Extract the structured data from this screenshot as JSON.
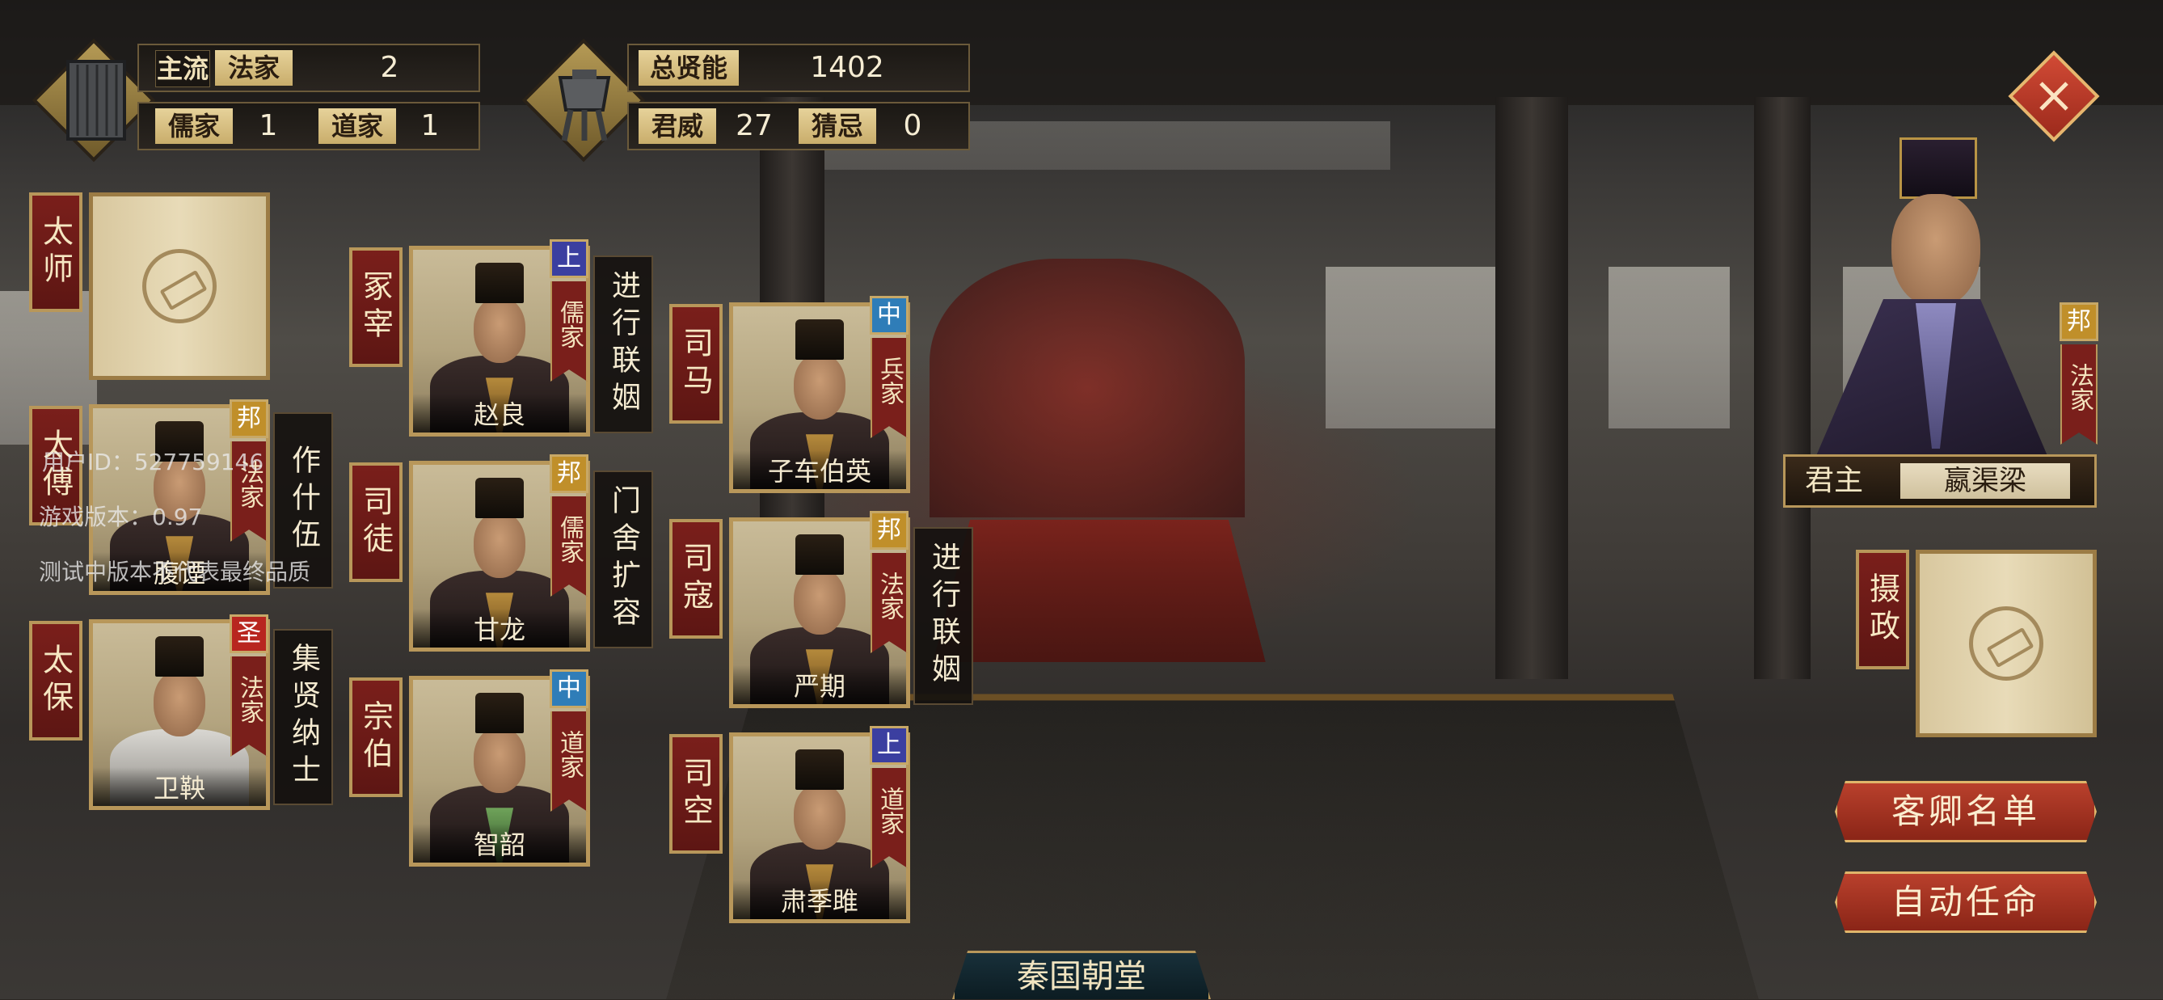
{
  "hud": {
    "mainstream_label": "主流",
    "mainstream_school": "法家",
    "mainstream_count": "2",
    "school2_label": "儒家",
    "school2_count": "1",
    "school3_label": "道家",
    "school3_count": "1",
    "total_talent_label": "总贤能",
    "total_talent_value": "1402",
    "prestige_label": "君威",
    "prestige_value": "27",
    "suspicion_label": "猜忌",
    "suspicion_value": "0"
  },
  "offices_left": [
    {
      "title": "太师",
      "empty": true
    },
    {
      "title": "太傅",
      "name": "腹𬤇",
      "rank": "邦",
      "school": "法家",
      "task": "作什伍"
    },
    {
      "title": "太保",
      "name": "卫鞅",
      "rank": "圣",
      "school": "法家",
      "task": "集贤纳士"
    }
  ],
  "offices_mid": [
    {
      "title": "冢宰",
      "name": "赵良",
      "rank": "上",
      "school": "儒家",
      "task": "进行联姻"
    },
    {
      "title": "司徒",
      "name": "甘龙",
      "rank": "邦",
      "school": "儒家",
      "task": "门舍扩容"
    },
    {
      "title": "宗伯",
      "name": "智韶",
      "rank": "中",
      "school": "道家",
      "task": ""
    }
  ],
  "offices_right": [
    {
      "title": "司马",
      "name": "子车伯英",
      "rank": "中",
      "school": "兵家",
      "task": ""
    },
    {
      "title": "司寇",
      "name": "严期",
      "rank": "邦",
      "school": "法家",
      "task": "进行联姻"
    },
    {
      "title": "司空",
      "name": "肃季雎",
      "rank": "上",
      "school": "道家",
      "task": ""
    }
  ],
  "ruler": {
    "label": "君主",
    "name": "嬴渠梁",
    "rank": "邦",
    "school": "法家"
  },
  "regent": {
    "title": "摄政"
  },
  "buttons": {
    "guest_list": "客卿名单",
    "auto_appoint": "自动任命"
  },
  "footer_title": "秦国朝堂",
  "watermark": {
    "user_id": "用户ID：527759146",
    "version": "游戏版本：0.97",
    "disclaimer": "测试中版本不代表最终品质"
  },
  "colors": {
    "rank_top": "#3b3fa0",
    "rank_mid": "#2f7db8",
    "rank_state": "#c08f2a",
    "rank_sage": "#b8261f"
  },
  "icons": [
    "scroll-icon",
    "bronze-vessel-icon",
    "close-icon",
    "empty-slot-icon"
  ]
}
